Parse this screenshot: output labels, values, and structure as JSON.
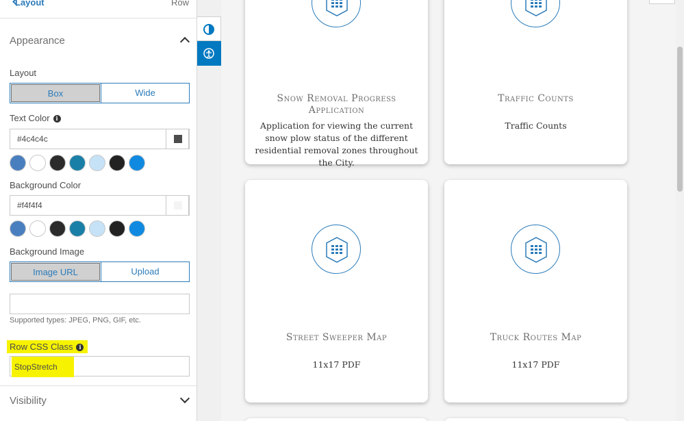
{
  "panel": {
    "back_label": "Layout",
    "header_right": "Row",
    "appearance_title": "Appearance",
    "layout_label": "Layout",
    "layout_options": [
      "Box",
      "Wide"
    ],
    "layout_selected": "Box",
    "text_color_label": "Text Color",
    "text_color_value": "#4c4c4c",
    "background_color_label": "Background Color",
    "background_color_value": "#f4f4f4",
    "swatch_colors": [
      "#4a7fbf",
      "#ffffff",
      "#2b2b2b",
      "#1a7fa6",
      "#c6e2f7",
      "#222222",
      "#0f8ae0"
    ],
    "background_image_label": "Background Image",
    "background_image_options": [
      "Image URL",
      "Upload"
    ],
    "background_image_selected": "Image URL",
    "image_url_value": "",
    "supported_types_hint": "Supported types: JPEG, PNG, GIF, etc.",
    "row_css_class_label": "Row CSS Class",
    "row_css_class_value": "StopStretch",
    "visibility_title": "Visibility"
  },
  "side_tabs": [
    {
      "name": "contrast-icon"
    },
    {
      "name": "accessibility-icon"
    }
  ],
  "cards": [
    {
      "title": "Snow Removal Progress Application",
      "description": "Application for viewing the current snow plow status of the different residential removal zones throughout the City.",
      "icon": "building-icon"
    },
    {
      "title": "Traffic Counts",
      "description": "Traffic Counts",
      "icon": "building-icon"
    },
    {
      "title": "Street Sweeper Map",
      "description": "11x17 PDF",
      "icon": "building-icon"
    },
    {
      "title": "Truck Routes Map",
      "description": "11x17 PDF",
      "icon": "building-icon"
    }
  ],
  "colors": {
    "accent": "#0079c1",
    "link": "#2b7bb9",
    "highlight": "#f6f200",
    "text": "#4c4c4c",
    "content_bg": "#f4f4f4"
  }
}
